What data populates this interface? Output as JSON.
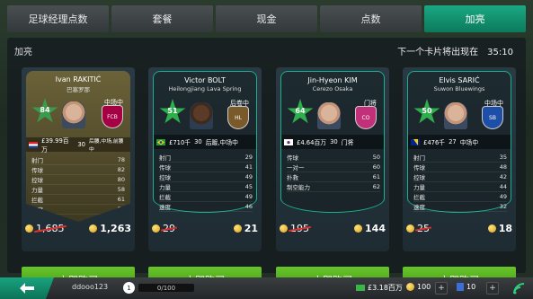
{
  "tabs": [
    "足球经理点数",
    "套餐",
    "现金",
    "点数",
    "加亮"
  ],
  "active_tab": 4,
  "panel": {
    "title": "加亮",
    "timer_label": "下一个卡片将出现在",
    "timer_value": "35:10"
  },
  "cards": [
    {
      "name": "Ivan RAKITIĆ",
      "club": "巴塞罗那",
      "rating": "84",
      "position": "中场中",
      "price_value": "£39.99百万",
      "age": "30",
      "roles": "后腰,中场,前腰中",
      "stats": [
        [
          "射门",
          "78"
        ],
        [
          "传球",
          "82"
        ],
        [
          "控球",
          "80"
        ],
        [
          "力量",
          "58"
        ],
        [
          "拦截",
          "61"
        ],
        [
          "速度",
          "57"
        ]
      ],
      "old_price": "1,685",
      "new_price": "1,263",
      "buy_label": "立即购买",
      "style": "gold",
      "crest": "FCB",
      "crest_color": "#a50044"
    },
    {
      "name": "Victor BOLT",
      "club": "Heilongjiang Lava Spring",
      "rating": "51",
      "position": "后卷中",
      "price_value": "£710千",
      "age": "30",
      "roles": "后踱,中场中",
      "stats": [
        [
          "射门",
          "29"
        ],
        [
          "传球",
          "41"
        ],
        [
          "控球",
          "49"
        ],
        [
          "力量",
          "45"
        ],
        [
          "拦截",
          "49"
        ],
        [
          "速度",
          "46"
        ]
      ],
      "old_price": "29",
      "new_price": "21",
      "buy_label": "立即购买",
      "style": "teal",
      "crest": "HL",
      "crest_color": "#7a5a2a"
    },
    {
      "name": "Jin-Hyeon KIM",
      "club": "Cerezo Osaka",
      "rating": "64",
      "position": "门将",
      "price_value": "£4.64百万",
      "age": "30",
      "roles": "门将",
      "stats": [
        [
          "传球",
          "50"
        ],
        [
          "一对一",
          "60"
        ],
        [
          "扑救",
          "61"
        ],
        [
          "制空能力",
          "62"
        ]
      ],
      "old_price": "195",
      "new_price": "144",
      "buy_label": "立即购买",
      "style": "teal",
      "crest": "CO",
      "crest_color": "#c2307a"
    },
    {
      "name": "Elvis SARIĆ",
      "club": "Suwon Bluewings",
      "rating": "50",
      "position": "中场中",
      "price_value": "£476千",
      "age": "27",
      "roles": "中场中",
      "stats": [
        [
          "射门",
          "35"
        ],
        [
          "传球",
          "48"
        ],
        [
          "控球",
          "42"
        ],
        [
          "力量",
          "44"
        ],
        [
          "拦截",
          "49"
        ],
        [
          "速度",
          "32"
        ]
      ],
      "old_price": "25",
      "new_price": "18",
      "buy_label": "立即购买",
      "style": "teal",
      "crest": "SB",
      "crest_color": "#1e4fa8"
    }
  ],
  "bottom": {
    "username": "ddooo123",
    "level": "1",
    "xp": "0/100",
    "money": "£3.18百万",
    "coins": "100",
    "gems": "10",
    "plus": "+"
  }
}
